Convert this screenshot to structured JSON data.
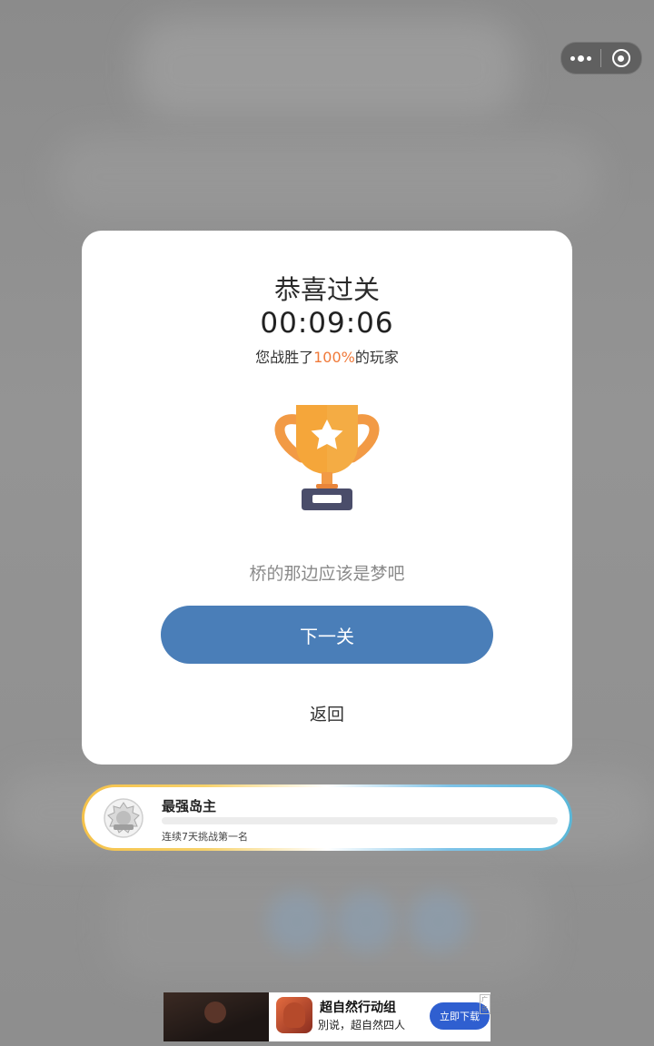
{
  "modal": {
    "title": "恭喜过关",
    "time": "00:09:06",
    "beat_prefix": "您战胜了",
    "beat_percent": "100%",
    "beat_suffix": "的玩家",
    "quote": "桥的那边应该是梦吧",
    "next_label": "下一关",
    "back_label": "返回"
  },
  "achievement": {
    "title": "最强岛主",
    "description": "连续7天挑战第一名"
  },
  "ad": {
    "title": "超自然行动组",
    "subtitle": "別说，超自然四人",
    "button": "立即下载",
    "tag": "广告"
  },
  "colors": {
    "primary_button": "#4a7eb8",
    "percent": "#f07a3a",
    "trophy_cup": "#f5a63a",
    "trophy_base": "#4a4d6a"
  },
  "icons": {
    "capsule_more": "more-dots-icon",
    "capsule_close": "close-target-icon",
    "trophy": "trophy-icon",
    "badge": "badge-icon"
  }
}
